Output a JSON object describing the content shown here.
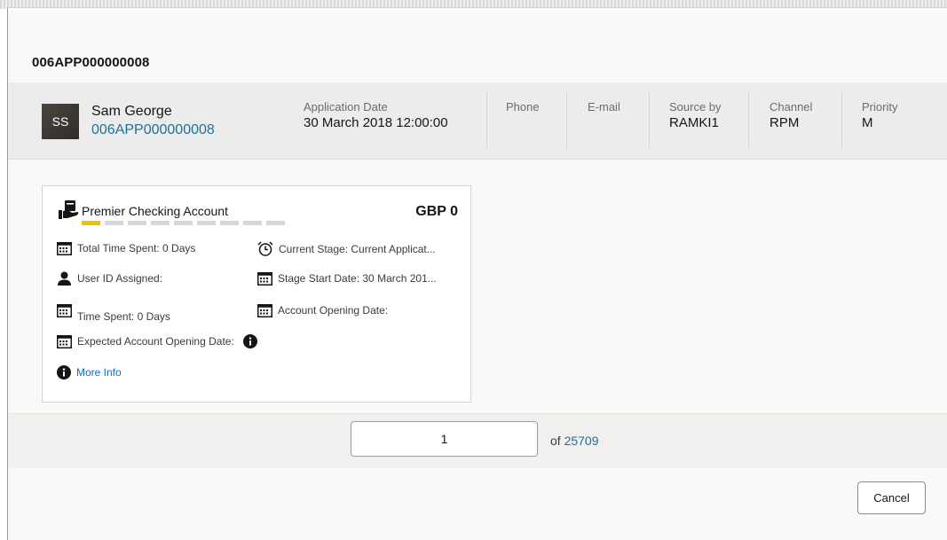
{
  "dialog": {
    "title": "006APP000000008"
  },
  "applicant": {
    "initials": "SS",
    "name": "Sam George",
    "id": "006APP000000008"
  },
  "header_fields": {
    "application_date_label": "Application Date",
    "application_date_value": "30 March 2018 12:00:00",
    "phone_label": "Phone",
    "email_label": "E-mail",
    "source_label": "Source by",
    "source_value": "RAMKI1",
    "channel_label": "Channel",
    "channel_value": "RPM",
    "priority_label": "Priority",
    "priority_value": "M"
  },
  "card": {
    "product_name": "Premier Checking Account",
    "amount": "GBP 0",
    "progress": {
      "completed": 1,
      "total": 9
    },
    "total_time_spent": "Total Time Spent: 0 Days",
    "current_stage": "Current Stage: Current Applicat...",
    "user_id_assigned": "User ID Assigned:",
    "stage_start_date": "Stage Start Date: 30 March 201...",
    "time_spent": "Time Spent: 0 Days",
    "account_opening_date": "Account Opening Date:",
    "expected_account_opening_date": "Expected Account Opening Date:",
    "more_info": "More Info"
  },
  "pagination": {
    "current_page": "1",
    "of_label": "of",
    "total_pages": "25709"
  },
  "footer": {
    "cancel_label": "Cancel"
  },
  "colors": {
    "link": "#227094",
    "progress_active": "#f0c000",
    "progress_inactive": "#d7d7d7"
  },
  "icons": [
    "calendar-icon",
    "alarm-clock-icon",
    "user-icon",
    "info-icon",
    "product-icon"
  ]
}
